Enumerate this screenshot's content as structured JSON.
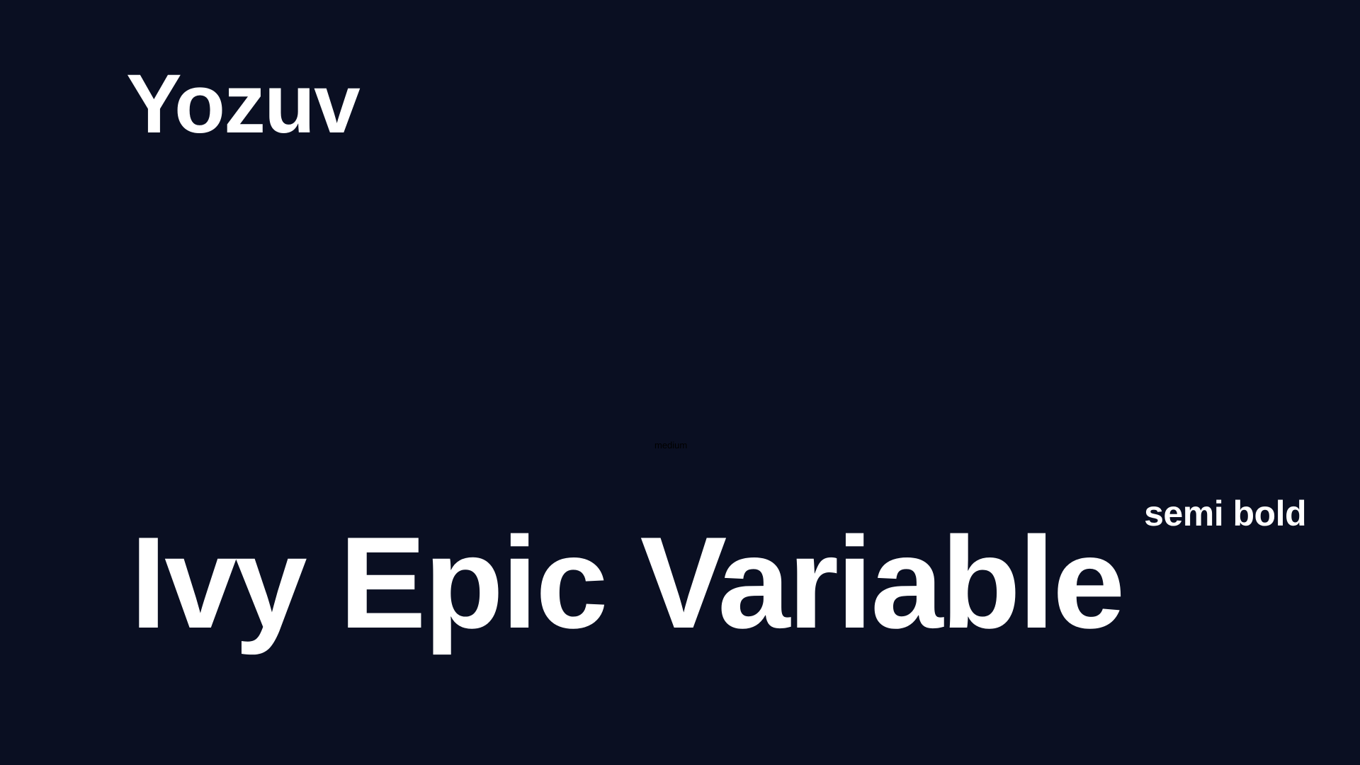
{
  "brand": {
    "name": "Yozuv"
  },
  "specimen": {
    "font_name": "Ivy Epic Variable",
    "weight_label_medium": "medium",
    "weight_label_semibold": "semi bold"
  },
  "colors": {
    "background": "#0a0f22",
    "text": "#ffffff",
    "hidden_label": "#000000"
  }
}
